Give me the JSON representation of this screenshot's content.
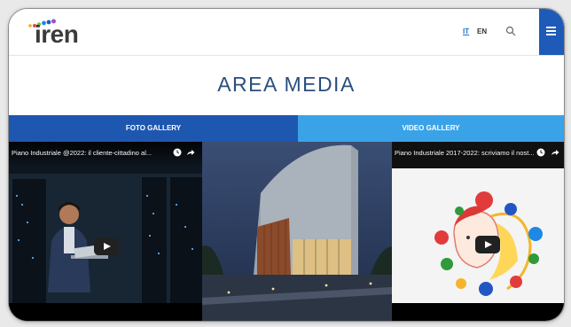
{
  "brand": {
    "logo_text": "iren",
    "dot_colors": [
      "#f5a623",
      "#e94b3c",
      "#7ac143",
      "#1e88e5",
      "#9c4fd6",
      "#f5a623"
    ]
  },
  "header": {
    "lang_it": "IT",
    "lang_en": "EN",
    "search_icon": "search-icon",
    "menu_icon": "hamburger-menu-icon",
    "menu_color": "#1e5bb8"
  },
  "page": {
    "title": "AREA MEDIA"
  },
  "tabs": [
    {
      "label": "FOTO GALLERY",
      "color": "#1e57b0"
    },
    {
      "label": "VIDEO GALLERY",
      "color": "#3aa3e8"
    }
  ],
  "media": {
    "video_1": {
      "title": "Piano Industriale @2022: il cliente-cittadino al...",
      "icons": [
        "clock-icon",
        "share-icon",
        "play-icon"
      ]
    },
    "photo": {
      "icon": "building-photo"
    },
    "video_2": {
      "title": "Piano Industriale 2017-2022: scriviamo il nost...",
      "icons": [
        "clock-icon",
        "share-icon",
        "play-icon"
      ]
    }
  }
}
